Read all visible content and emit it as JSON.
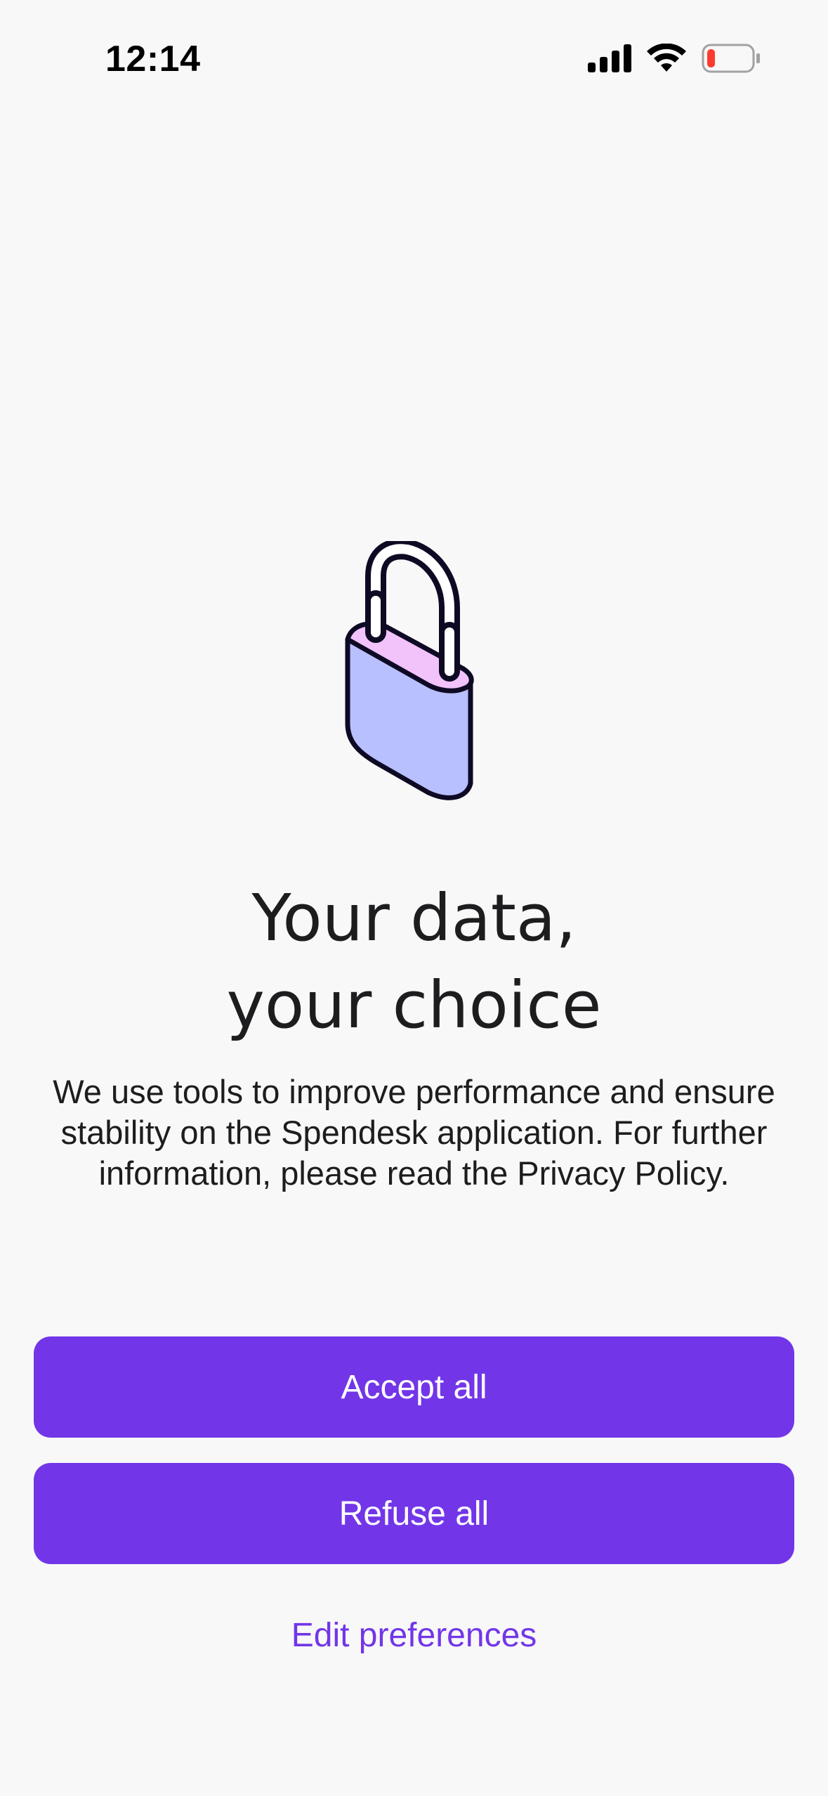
{
  "status_bar": {
    "time": "12:14",
    "icons": [
      "cellular-signal-icon",
      "wifi-icon",
      "battery-low-icon"
    ]
  },
  "illustration": {
    "icon": "padlock-icon",
    "colors": {
      "body": "#b8c0ff",
      "top": "#f2c2fb",
      "outline": "#0e0a24"
    }
  },
  "consent": {
    "title_line1": "Your data,",
    "title_line2": "your choice",
    "description": "We use tools to improve performance and ensure stability on the Spendesk application. For further information, please read the Privacy Policy.",
    "accept_label": "Accept all",
    "refuse_label": "Refuse all",
    "edit_label": "Edit preferences"
  },
  "colors": {
    "accent": "#7236e8",
    "background": "#f8f8f8",
    "battery_low": "#ff3b30"
  }
}
